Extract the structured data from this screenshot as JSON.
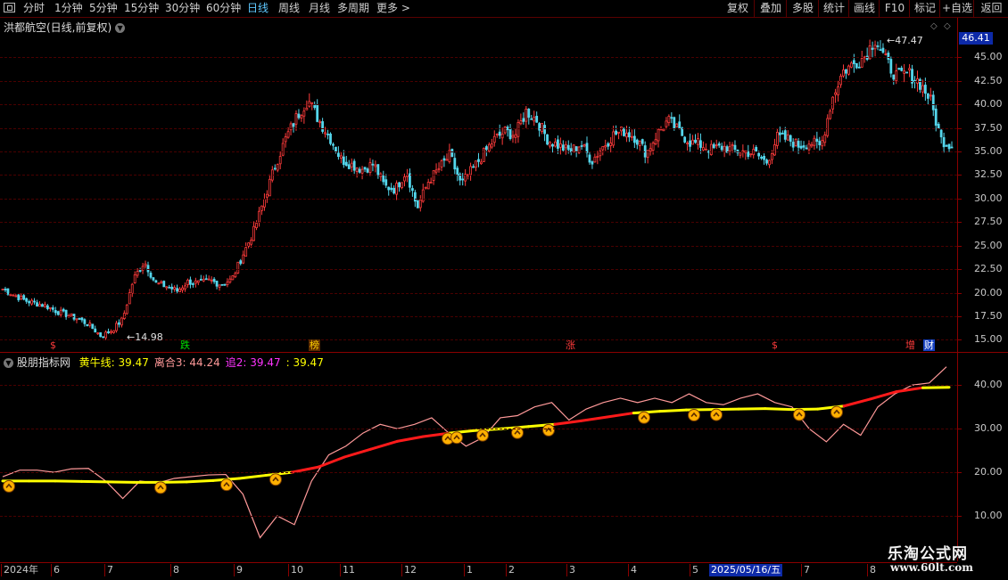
{
  "toolbar": {
    "periods": [
      "分时",
      "1分钟",
      "5分钟",
      "15分钟",
      "30分钟",
      "60分钟",
      "日线",
      "周线",
      "月线",
      "多周期",
      "更多 >"
    ],
    "active_period": "日线",
    "tools": [
      "复权",
      "叠加",
      "多股",
      "统计",
      "画线",
      "F10",
      "标记",
      "+自选",
      "返回"
    ]
  },
  "main_chart": {
    "title": "洪都航空(日线,前复权)",
    "current_price": "46.41",
    "high_callout": "47.47",
    "low_callout": "14.98",
    "y_labels": [
      "45.00",
      "42.50",
      "40.00",
      "37.50",
      "35.00",
      "32.50",
      "30.00",
      "27.50",
      "25.00",
      "22.50",
      "20.00",
      "17.50",
      "15.00"
    ],
    "events": [
      {
        "label": "$",
        "color": "#ff3b3b"
      },
      {
        "label": "跌",
        "color": "#00e000"
      },
      {
        "label": "榜",
        "color": "#ffd000",
        "bg": "#5a2a00"
      },
      {
        "label": "涨",
        "color": "#ff3b3b"
      },
      {
        "label": "$",
        "color": "#ff3b3b"
      },
      {
        "label": "增",
        "color": "#ff3b3b"
      },
      {
        "label": "财",
        "color": "#ffffff",
        "bg": "#1540c0"
      }
    ]
  },
  "indicator": {
    "name": "股朋指标网",
    "items": [
      {
        "label": "黄牛线: ",
        "value": "39.47",
        "color": "#ffff00"
      },
      {
        "label": "离合3: ",
        "value": "44.24",
        "color": "#ff9999"
      },
      {
        "label": "追2: ",
        "value": "39.47",
        "color": "#ff33ff"
      },
      {
        "label": ": ",
        "value": "39.47",
        "color": "#ffff00"
      }
    ],
    "y_labels": [
      "40.00",
      "30.00",
      "20.00",
      "10.00"
    ]
  },
  "date_axis": {
    "labels": [
      "2024年",
      "6",
      "7",
      "8",
      "9",
      "10",
      "11",
      "12",
      "1",
      "2",
      "3",
      "4",
      "5",
      "6",
      "7",
      "8"
    ],
    "cursor_date": "2025/05/16/五"
  },
  "watermark": {
    "text": "乐淘公式网",
    "url": "www.60lt.com"
  },
  "colors": {
    "up": "#ff3b3b",
    "down": "#54d6ec",
    "yellow_line": "#ffff00",
    "pink_line": "#ff9999"
  },
  "chart_data": {
    "type": "candlestick",
    "x": [
      "2024年",
      "6",
      "7",
      "8",
      "9",
      "10",
      "11",
      "12",
      "1",
      "2",
      "3",
      "4",
      "5",
      "6",
      "7",
      "8"
    ],
    "series": [
      {
        "values": [
          20.4,
          19.8,
          19.2,
          18.9,
          18.6,
          18.0,
          17.6,
          17.2,
          16.5,
          15.4,
          16.0,
          17.2,
          21.5,
          23.3,
          21.0,
          20.7,
          20.2,
          21.2,
          21.0,
          21.3,
          20.9,
          21.4,
          24.0,
          26.5,
          30.0,
          33.6,
          36.5,
          38.8,
          40.5,
          38.3,
          36.5,
          34.2,
          33.6,
          33.1,
          33.7,
          31.3,
          31.0,
          33.0,
          29.0,
          31.8,
          33.2,
          34.6,
          31.5,
          33.0,
          34.6,
          36.2,
          37.1,
          36.8,
          39.3,
          38.3,
          36.2,
          35.6,
          35.0,
          35.8,
          34.0,
          35.5,
          36.8,
          37.2,
          36.5,
          34.8,
          36.9,
          38.3,
          37.1,
          36.0,
          35.7,
          35.2,
          35.5,
          35.1,
          35.0,
          34.8,
          33.8,
          36.5,
          36.3,
          35.6,
          36.0,
          35.5,
          40.5,
          43.5,
          44.3,
          45.1,
          47.0,
          44.5,
          42.9,
          43.3,
          42.4,
          40.6,
          36.3,
          35.6
        ]
      }
    ],
    "indicator_series": [
      {
        "name": "黄牛线",
        "values": [
          18.0,
          18.0,
          18.0,
          17.9,
          17.8,
          17.7,
          17.7,
          17.8,
          18.1,
          18.6,
          19.3,
          20.0,
          21.2,
          23.5,
          25.3,
          27.1,
          28.2,
          29.0,
          29.6,
          30.0,
          30.5,
          31.0,
          31.8,
          32.7,
          33.6,
          34.0,
          34.3,
          34.4,
          34.5,
          34.6,
          34.4,
          34.5,
          35.2,
          36.8,
          38.5,
          39.4,
          39.5
        ]
      },
      {
        "name": "离合3",
        "values": [
          19.0,
          20.5,
          20.5,
          20.0,
          20.8,
          20.9,
          18.0,
          14.0,
          18.0,
          17.5,
          18.6,
          19.0,
          19.4,
          19.5,
          15.0,
          5.0,
          10.0,
          8.0,
          18.0,
          24.0,
          26.0,
          29.0,
          31.0,
          30.0,
          31.0,
          32.5,
          29.0,
          26.0,
          28.0,
          32.5,
          33.0,
          35.0,
          36.0,
          32.0,
          34.5,
          36.0,
          37.0,
          36.0,
          37.0,
          36.0,
          38.0,
          36.0,
          35.5,
          37.0,
          38.0,
          36.0,
          35.0,
          30.0,
          27.0,
          31.0,
          28.5,
          35.0,
          38.0,
          40.0,
          40.5,
          44.2
        ]
      }
    ],
    "ylim": [
      14.0,
      49.0
    ],
    "indicator_ylim": [
      0,
      47.0
    ]
  }
}
